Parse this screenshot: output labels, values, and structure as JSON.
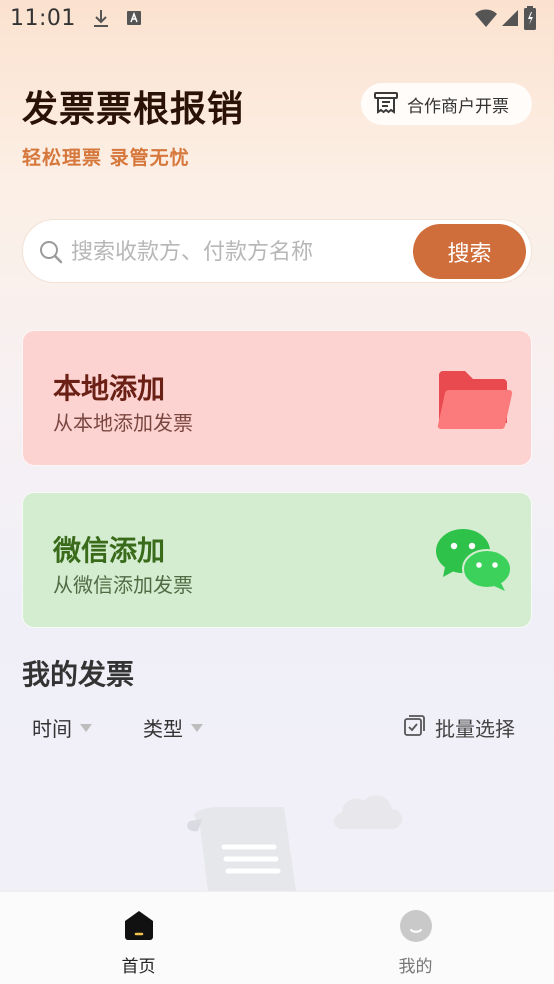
{
  "status_bar": {
    "time": "11:01"
  },
  "header": {
    "title": "发票票根报销",
    "subtitle": "轻松理票 录管无忧",
    "merchant_button_label": "合作商户开票"
  },
  "search": {
    "placeholder": "搜索收款方、付款方名称",
    "button_label": "搜索"
  },
  "cards": [
    {
      "title": "本地添加",
      "subtitle": "从本地添加发票"
    },
    {
      "title": "微信添加",
      "subtitle": "从微信添加发票"
    }
  ],
  "invoices": {
    "title": "我的发票",
    "filters": [
      "时间",
      "类型"
    ],
    "batch_select_label": "批量选择"
  },
  "bottom_nav": {
    "items": [
      {
        "label": "首页",
        "active": true
      },
      {
        "label": "我的",
        "active": false
      }
    ]
  },
  "colors": {
    "accent": "#cf6e3b",
    "subtitle": "#d6773c",
    "local_card": "#fdd3d2",
    "wechat_card": "#d4ecd0",
    "wechat_green": "#2ec24a"
  }
}
